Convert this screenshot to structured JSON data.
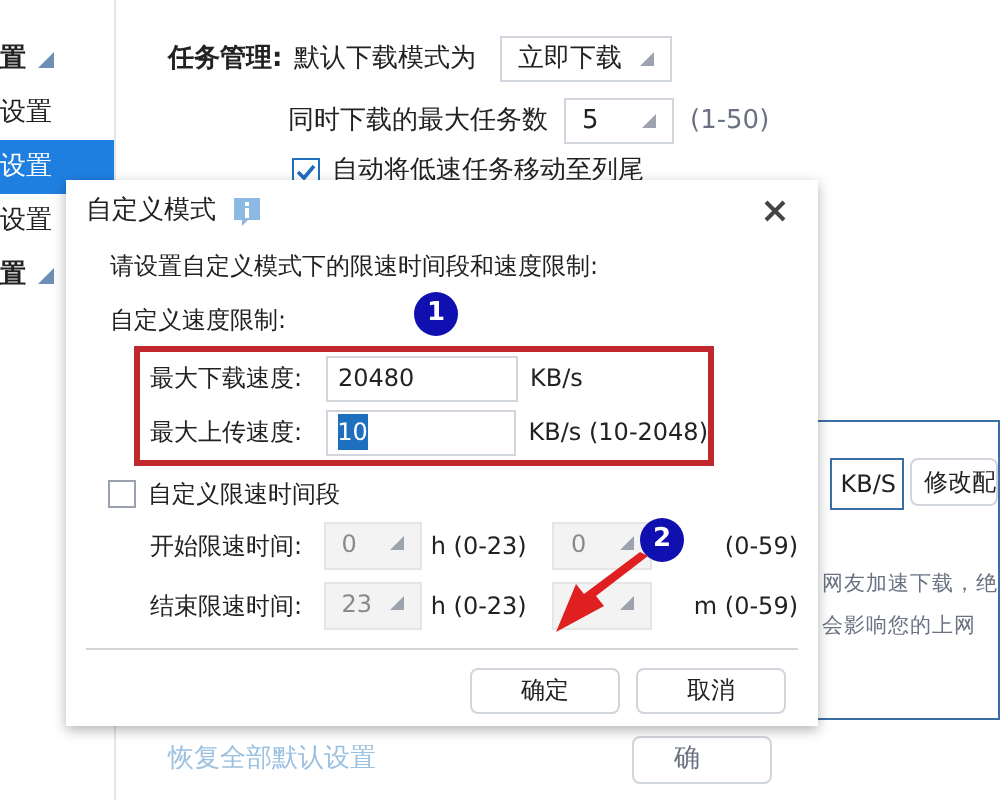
{
  "sidebar": {
    "items": [
      {
        "label": "置",
        "selected": false,
        "expandable": true
      },
      {
        "label": "设置",
        "selected": false,
        "expandable": false
      },
      {
        "label": "设置",
        "selected": true,
        "expandable": false
      },
      {
        "label": "设置",
        "selected": false,
        "expandable": false
      },
      {
        "label": "置",
        "selected": false,
        "expandable": true
      }
    ]
  },
  "task_management": {
    "heading": "任务管理:",
    "mode_label": "默认下载模式为",
    "mode_value": "立即下载",
    "max_tasks_label": "同时下载的最大任务数",
    "max_tasks_value": "5",
    "max_tasks_range": "(1-50)",
    "auto_move": {
      "label": "自动将低速任务移动至列尾",
      "checked": true
    }
  },
  "background_panel": {
    "unit_box": "KB/S",
    "modify_button": "修改配",
    "notes": [
      "网友加速下载，绝",
      "会影响您的上网"
    ]
  },
  "footer": {
    "restore_link": "恢复全部默认设置",
    "confirm_button": "确"
  },
  "dialog": {
    "title": "自定义模式",
    "intro": "请设置自定义模式下的限速时间段和速度限制:",
    "speed_section": "自定义速度限制:",
    "speed_rows": [
      {
        "label": "最大下载速度:",
        "value": "20480",
        "highlighted": false,
        "unit": "KB/s"
      },
      {
        "label": "最大上传速度:",
        "value": "10",
        "highlighted": true,
        "unit": "KB/s (10-2048)"
      }
    ],
    "time_limit": {
      "label": "自定义限速时间段",
      "checked": false
    },
    "time_rows": [
      {
        "label": "开始限速时间:",
        "hour": "0",
        "hour_unit": "h (0-23)",
        "minute": "0",
        "minute_unit": "(0-59)",
        "disabled": true
      },
      {
        "label": "结束限速时间:",
        "hour": "23",
        "hour_unit": "h (0-23)",
        "minute_unit": "m (0-59)",
        "disabled": true
      }
    ],
    "buttons": [
      "确定",
      "取消"
    ]
  },
  "annotations": [
    "1",
    "2"
  ]
}
